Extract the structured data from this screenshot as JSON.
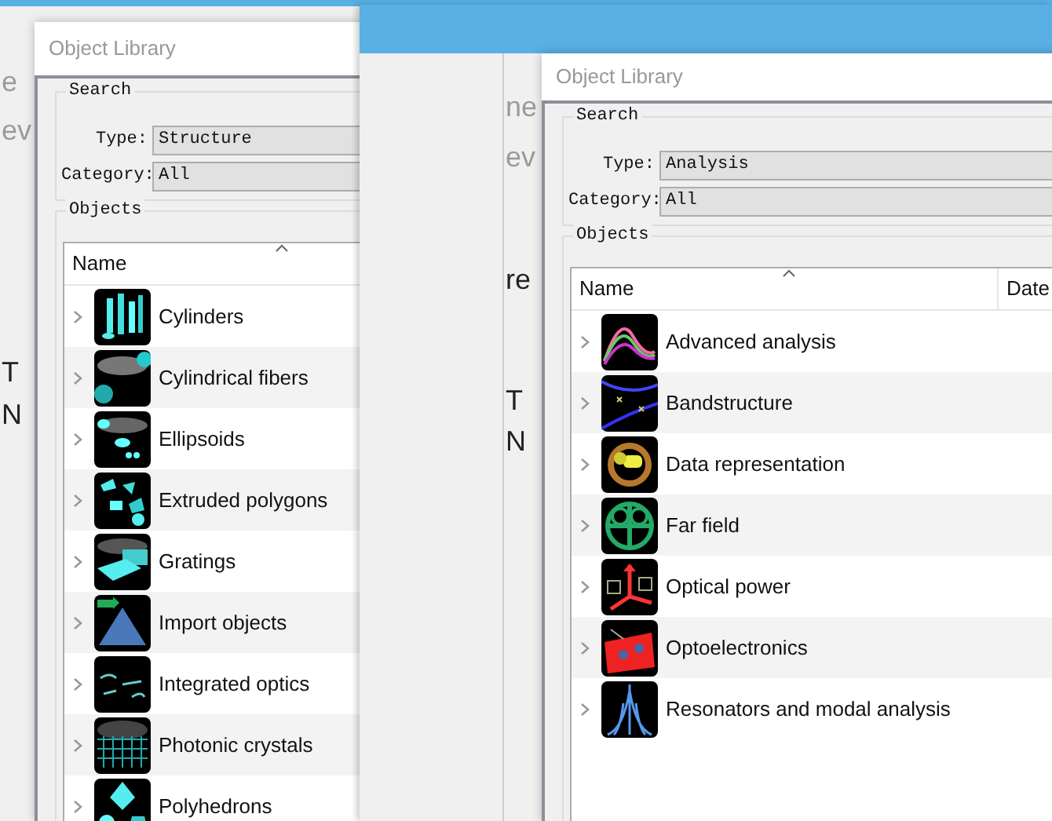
{
  "background_fragments": [
    {
      "text": "e",
      "dimmed": true
    },
    {
      "text": "ev",
      "dimmed": true
    },
    {
      "text": "T",
      "dimmed": false
    },
    {
      "text": "N",
      "dimmed": false
    }
  ],
  "inner_fragments": [
    {
      "text": "ne",
      "dimmed": true
    },
    {
      "text": "ev",
      "dimmed": true
    },
    {
      "text": "re",
      "dimmed": false
    },
    {
      "text": "T",
      "dimmed": false
    },
    {
      "text": "N",
      "dimmed": false
    }
  ],
  "dialogs": [
    {
      "title": "Object Library",
      "search": {
        "title": "Search",
        "fields": [
          {
            "label": "Type:",
            "value": "Structure"
          },
          {
            "label": "Category:",
            "value": "All"
          }
        ]
      },
      "objects": {
        "title": "Objects",
        "columns": [
          "Name"
        ],
        "rows": [
          {
            "name": "Cylinders",
            "expanded": false
          },
          {
            "name": "Cylindrical fibers",
            "expanded": false
          },
          {
            "name": "Ellipsoids",
            "expanded": false
          },
          {
            "name": "Extruded polygons",
            "expanded": false
          },
          {
            "name": "Gratings",
            "expanded": false
          },
          {
            "name": "Import objects",
            "expanded": false
          },
          {
            "name": "Integrated optics",
            "expanded": false
          },
          {
            "name": "Photonic crystals",
            "expanded": false
          },
          {
            "name": "Polyhedrons",
            "expanded": false
          }
        ]
      }
    },
    {
      "title": "Object Library",
      "search": {
        "title": "Search",
        "fields": [
          {
            "label": "Type:",
            "value": "Analysis"
          },
          {
            "label": "Category:",
            "value": "All"
          }
        ]
      },
      "objects": {
        "title": "Objects",
        "columns": [
          "Name",
          "Date"
        ],
        "rows": [
          {
            "name": "Advanced analysis",
            "expanded": false
          },
          {
            "name": "Bandstructure",
            "expanded": false
          },
          {
            "name": "Data representation",
            "expanded": false
          },
          {
            "name": "Far field",
            "expanded": false
          },
          {
            "name": "Optical power",
            "expanded": false
          },
          {
            "name": "Optoelectronics",
            "expanded": false
          },
          {
            "name": "Resonators and modal analysis",
            "expanded": false
          }
        ]
      }
    }
  ]
}
